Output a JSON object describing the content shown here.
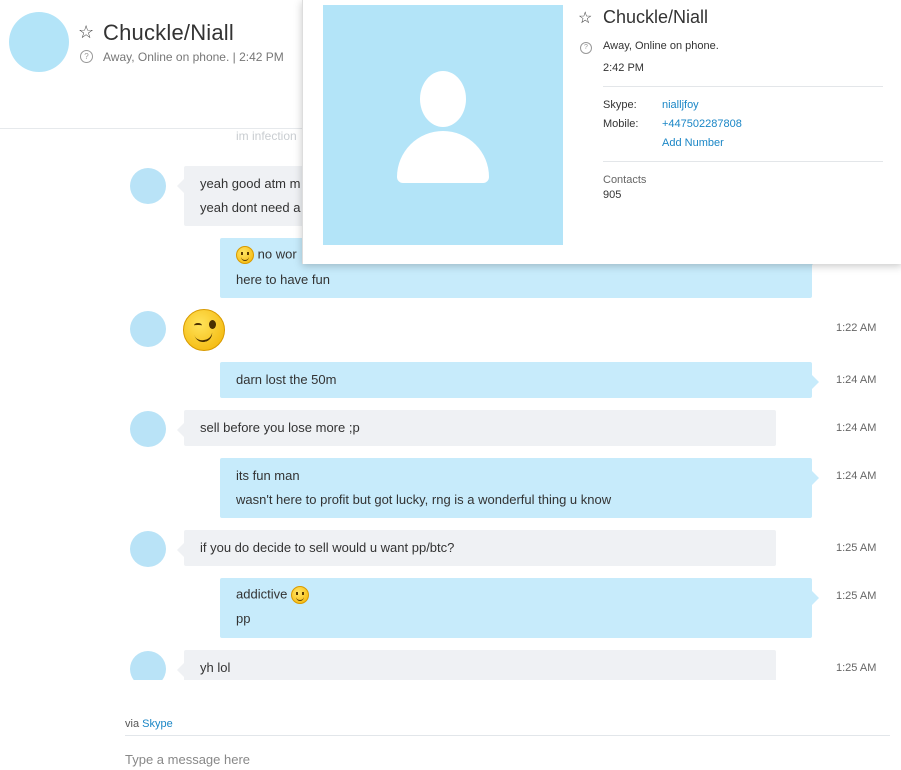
{
  "header": {
    "contact_name": "Chuckle/Niall",
    "status": "Away, Online on phone.  |  2:42 PM",
    "star_icon": "☆",
    "help_icon": "?"
  },
  "chat": {
    "ghost_text": "im infection",
    "messages": [
      {
        "dir": "in",
        "lines": [
          "yeah good atm m",
          "yeah dont need a"
        ],
        "time": ""
      },
      {
        "dir": "out",
        "lines": [
          "no wor",
          "here to have fun"
        ],
        "time": ""
      },
      {
        "dir": "in",
        "lines": [],
        "emoji": "wink",
        "time": "1:22 AM"
      },
      {
        "dir": "out",
        "lines": [
          "darn lost the 50m"
        ],
        "time": "1:24 AM"
      },
      {
        "dir": "in",
        "lines": [
          "sell before you lose more ;p"
        ],
        "time": "1:24 AM"
      },
      {
        "dir": "out",
        "lines": [
          "its fun man",
          "wasn't here to profit but got lucky, rng is a wonderful thing u know"
        ],
        "time": "1:24 AM"
      },
      {
        "dir": "in",
        "lines": [
          "if you do decide to sell would u want pp/btc?"
        ],
        "time": "1:25 AM"
      },
      {
        "dir": "out",
        "lines": [
          "addictive",
          "pp"
        ],
        "time": "1:25 AM"
      },
      {
        "dir": "in",
        "lines": [
          "yh lol"
        ],
        "time": "1:25 AM"
      }
    ]
  },
  "footer": {
    "via_prefix": "via ",
    "via_link": "Skype",
    "input_placeholder": "Type a message here"
  },
  "profile_card": {
    "name": "Chuckle/Niall",
    "status": "Away, Online on phone.",
    "local_time": "2:42 PM",
    "skype_label": "Skype:",
    "skype_value": "nialljfoy",
    "mobile_label": "Mobile:",
    "mobile_value": "+447502287808",
    "add_number": "Add Number",
    "contacts_label": "Contacts",
    "contacts_count": "905"
  }
}
